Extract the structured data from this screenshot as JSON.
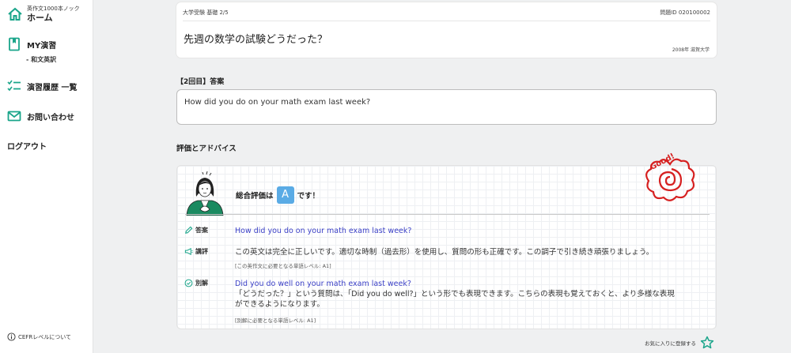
{
  "sidebar": {
    "home_sub": "英作文1000本ノック",
    "home_label": "ホーム",
    "my_practice_label": "MY演習",
    "my_practice_sub": "- 和文英訳",
    "history_label": "演習履歴 一覧",
    "contact_label": "お問い合わせ",
    "logout_label": "ログアウト",
    "cefr_label": "CEFRレベルについて"
  },
  "question": {
    "category": "大学受験 基礎",
    "progress": "2/5",
    "id_label": "問題ID 020100002",
    "text": "先週の数学の試験どうだった？",
    "source": "2008年 滋賀大学"
  },
  "answer": {
    "label": "【2回目】答案",
    "text": "How did you do on your math exam last week?"
  },
  "evaluation": {
    "title": "評価とアドバイス",
    "overall_prefix": "総合評価は",
    "grade": "A",
    "overall_suffix": "です！",
    "stamp_text": "Good!",
    "answer_label": "答案",
    "answer_text": "How did you do on your math exam last week?",
    "review_label": "講評",
    "review_text": "この英文は完全に正しいです。適切な時制（過去形）を使用し、質問の形も正確です。この調子で引き続き頑張りましょう。",
    "review_note": "[この英作文に必要となる単語レベル: A1]",
    "alt_label": "別解",
    "alt_text": "Did you do well on your math exam last week?",
    "alt_explain_1": "「どうだった？」という質問は、「Did you do well?」という形でも表現できます。こちらの表現も覚えておくと、より多様な表現",
    "alt_explain_2": "ができるようになります。",
    "alt_note": "[別解に必要となる単語レベル: A1]"
  },
  "favorite_label": "お気に入りに登録する",
  "colors": {
    "accent": "#1aa58a",
    "grade": "#5aabe5",
    "english": "#3a3fc6",
    "stamp": "#d62020"
  }
}
